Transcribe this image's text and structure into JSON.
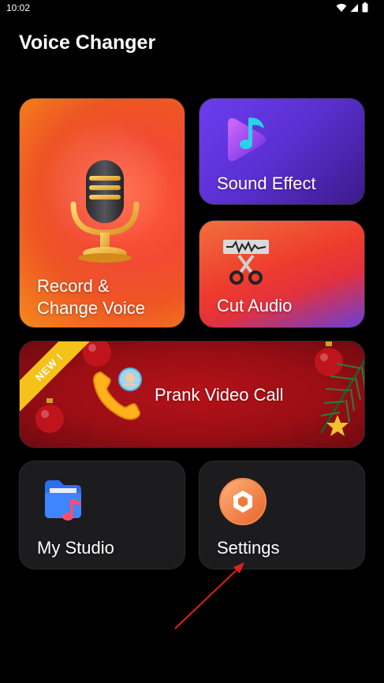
{
  "status_bar": {
    "time": "10:02"
  },
  "app": {
    "title": "Voice Changer"
  },
  "cards": {
    "record": {
      "label_line1": "Record &",
      "label_line2": "Change Voice"
    },
    "sound_effect": {
      "label": "Sound Effect"
    },
    "cut_audio": {
      "label": "Cut Audio"
    },
    "prank": {
      "label": "Prank Video Call",
      "badge": "NEW !"
    },
    "studio": {
      "label": "My Studio"
    },
    "settings": {
      "label": "Settings"
    }
  },
  "icons": {
    "record": "microphone-icon",
    "sound_effect": "music-note-icon",
    "cut_audio": "scissors-icon",
    "prank": "phone-icon",
    "studio": "folder-music-icon",
    "settings": "gear-icon"
  },
  "colors": {
    "background": "#000000",
    "accent_orange": "#f24a33",
    "accent_purple": "#6a3df0",
    "prank_red": "#9a0e14",
    "dark_card": "#1c1c1e",
    "badge_yellow": "#f5c21b"
  }
}
